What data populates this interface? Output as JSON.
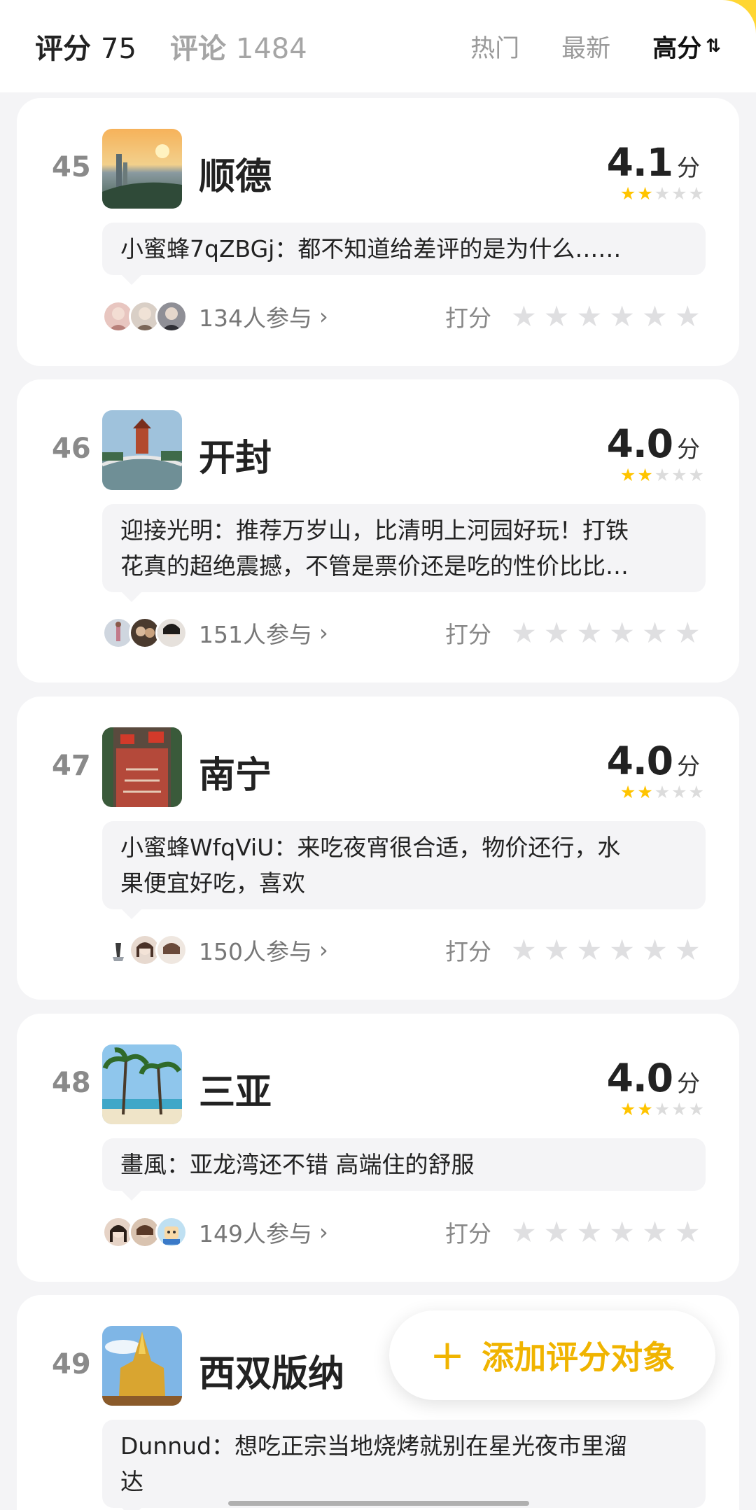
{
  "header": {
    "rating_label": "评分",
    "rating_count": "75",
    "comment_label": "评论",
    "comment_count": "1484",
    "sort_hot": "热门",
    "sort_latest": "最新",
    "sort_high": "高分",
    "sort_icon": "⇅"
  },
  "items": [
    {
      "rank": "45",
      "city": "顺德",
      "score": "4.1",
      "unit": "分",
      "comment_line1": "小蜜蜂7qZBGj：都不知道给差评的是为什么……",
      "comment_line2": "",
      "participants": "134人参与",
      "rate_label": "打分"
    },
    {
      "rank": "46",
      "city": "开封",
      "score": "4.0",
      "unit": "分",
      "comment_line1": "迎接光明：推荐万岁山，比清明上河园好玩！打铁",
      "comment_line2": "花真的超绝震撼，不管是票价还是吃的性价比比…",
      "participants": "151人参与",
      "rate_label": "打分"
    },
    {
      "rank": "47",
      "city": "南宁",
      "score": "4.0",
      "unit": "分",
      "comment_line1": "小蜜蜂WfqViU：来吃夜宵很合适，物价还行，水",
      "comment_line2": "果便宜好吃，喜欢",
      "participants": "150人参与",
      "rate_label": "打分"
    },
    {
      "rank": "48",
      "city": "三亚",
      "score": "4.0",
      "unit": "分",
      "comment_line1": "畫風：亚龙湾还不错 高端住的舒服",
      "comment_line2": "",
      "participants": "149人参与",
      "rate_label": "打分"
    },
    {
      "rank": "49",
      "city": "西双版纳",
      "comment_line1": "Dunnud：想吃正宗当地烧烤就别在星光夜市里溜",
      "comment_line2": "达"
    }
  ],
  "fab": {
    "plus": "+",
    "label": "添加评分对象"
  },
  "icons": {
    "star_filled": "★",
    "star_empty": "★",
    "chevron": "›"
  },
  "colors": {
    "accent": "#ffc400",
    "fab_text": "#f0b400",
    "background": "#f4f4f6"
  }
}
